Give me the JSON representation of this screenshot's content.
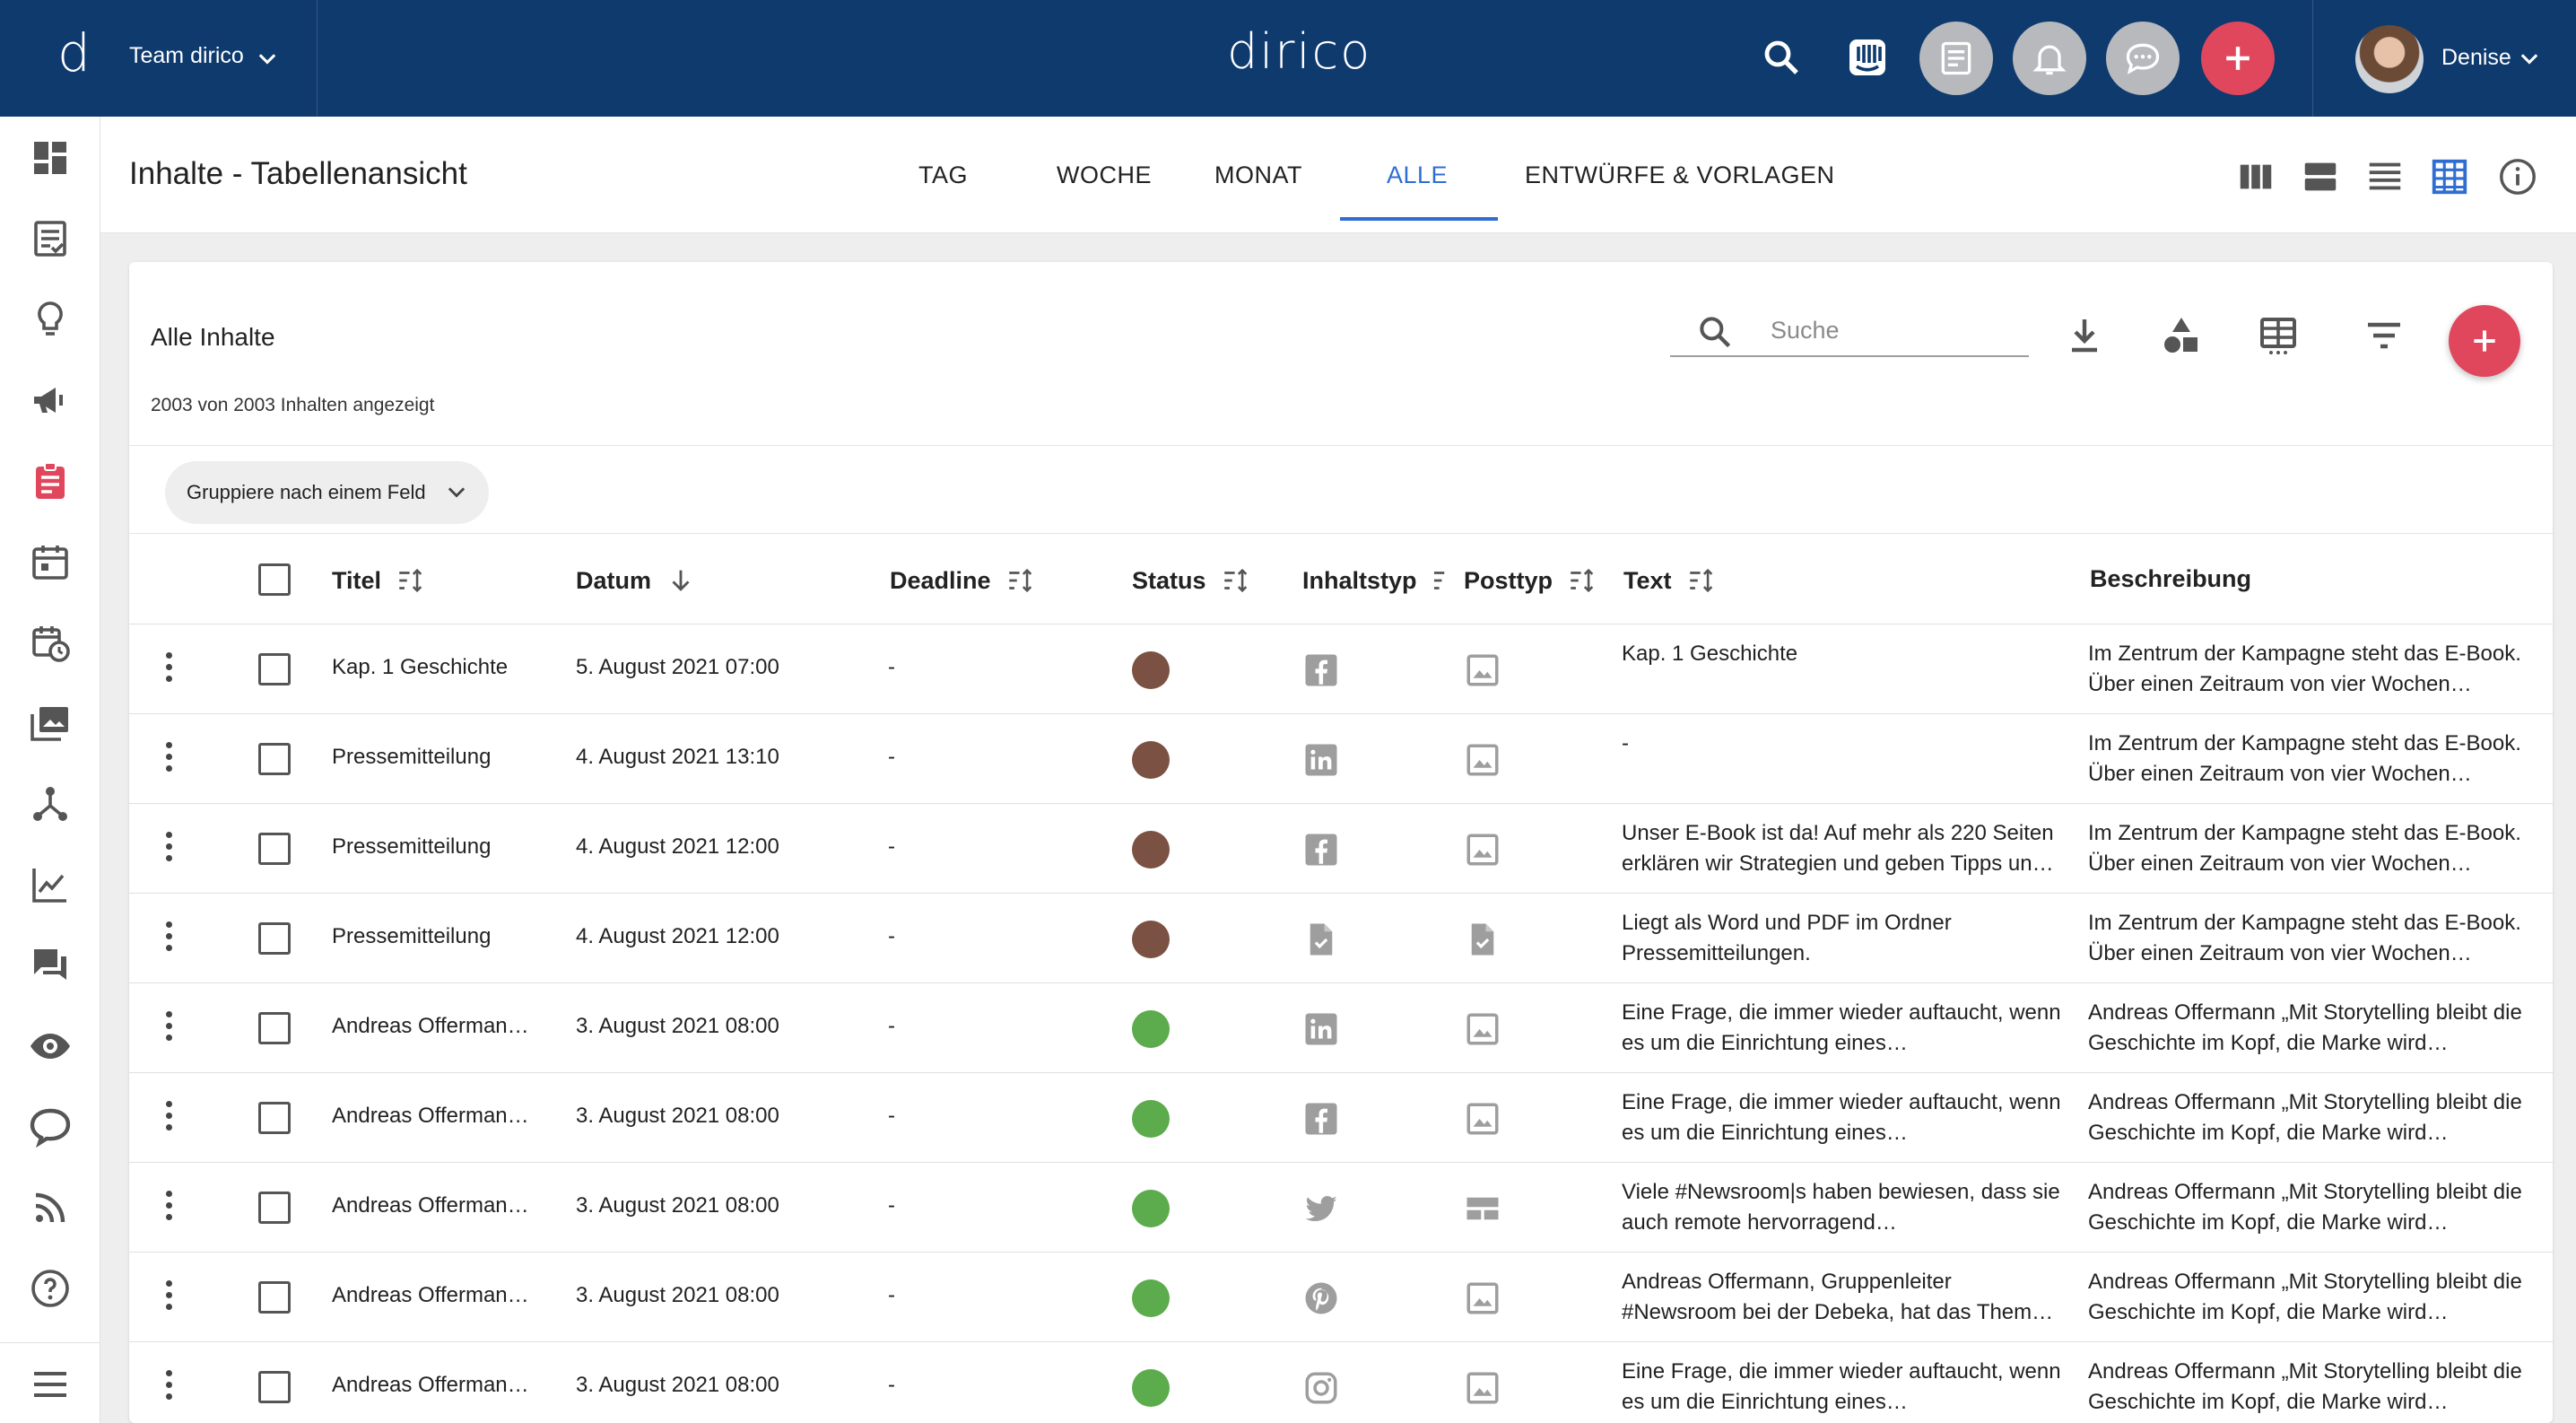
{
  "topbar": {
    "logo": "d",
    "team": "Team dirico",
    "brand": "dirico",
    "user": "Denise",
    "bg_color": "#0e3a6e",
    "accent_color": "#e0475d"
  },
  "header": {
    "title": "Inhalte - Tabellenansicht",
    "tabs": [
      {
        "label": "TAG",
        "active": false
      },
      {
        "label": "WOCHE",
        "active": false
      },
      {
        "label": "MONAT",
        "active": false
      },
      {
        "label": "ALLE",
        "active": true
      },
      {
        "label": "ENTWÜRFE & VORLAGEN",
        "active": false
      }
    ]
  },
  "card": {
    "title": "Alle Inhalte",
    "count": "2003 von 2003 Inhalten angezeigt",
    "search_placeholder": "Suche",
    "group_chip": "Gruppiere nach einem Feld"
  },
  "table": {
    "columns": {
      "title": "Titel",
      "date": "Datum",
      "deadline": "Deadline",
      "status": "Status",
      "content_type": "Inhaltstyp",
      "post_type": "Posttyp",
      "text": "Text",
      "description": "Beschreibung"
    },
    "rows": [
      {
        "title": "Kap. 1 Geschichte",
        "date": "5. August 2021 07:00",
        "deadline": "-",
        "status_color": "#7a5142",
        "content_icon": "facebook-icon",
        "post_icon": "image-icon",
        "text": "Kap. 1 Geschichte",
        "description": "Im Zentrum der Kampagne steht das E-Book. Über einen Zeitraum von vier Wochen…"
      },
      {
        "title": "Pressemitteilung",
        "date": "4. August 2021 13:10",
        "deadline": "-",
        "status_color": "#7a5142",
        "content_icon": "linkedin-icon",
        "post_icon": "image-icon",
        "text": "-",
        "description": "Im Zentrum der Kampagne steht das E-Book. Über einen Zeitraum von vier Wochen…"
      },
      {
        "title": "Pressemitteilung",
        "date": "4. August 2021 12:00",
        "deadline": "-",
        "status_color": "#7a5142",
        "content_icon": "facebook-icon",
        "post_icon": "image-icon",
        "text": "Unser E-Book ist da! Auf mehr als 220 Seiten erklären wir Strategien und geben Tipps un…",
        "description": "Im Zentrum der Kampagne steht das E-Book. Über einen Zeitraum von vier Wochen…"
      },
      {
        "title": "Pressemitteilung",
        "date": "4. August 2021 12:00",
        "deadline": "-",
        "status_color": "#7a5142",
        "content_icon": "document-check-icon",
        "post_icon": "document-check-icon",
        "text": "Liegt als Word und PDF im Ordner Pressemitteilungen.",
        "description": "Im Zentrum der Kampagne steht das E-Book. Über einen Zeitraum von vier Wochen…"
      },
      {
        "title": "Andreas Offerman…",
        "date": "3. August 2021 08:00",
        "deadline": "-",
        "status_color": "#5cab4c",
        "content_icon": "linkedin-icon",
        "post_icon": "image-icon",
        "text": "Eine Frage, die immer wieder auftaucht, wenn es um die Einrichtung eines…",
        "description": "Andreas Offermann „Mit Storytelling bleibt die Geschichte im Kopf, die Marke wird…"
      },
      {
        "title": "Andreas Offerman…",
        "date": "3. August 2021 08:00",
        "deadline": "-",
        "status_color": "#5cab4c",
        "content_icon": "facebook-icon",
        "post_icon": "image-icon",
        "text": "Eine Frage, die immer wieder auftaucht, wenn es um die Einrichtung eines…",
        "description": "Andreas Offermann „Mit Storytelling bleibt die Geschichte im Kopf, die Marke wird…"
      },
      {
        "title": "Andreas Offerman…",
        "date": "3. August 2021 08:00",
        "deadline": "-",
        "status_color": "#5cab4c",
        "content_icon": "twitter-icon",
        "post_icon": "card-layout-icon",
        "text": "Viele #Newsroom|s haben bewiesen, dass sie auch remote hervorragend…",
        "description": "Andreas Offermann „Mit Storytelling bleibt die Geschichte im Kopf, die Marke wird…"
      },
      {
        "title": "Andreas Offerman…",
        "date": "3. August 2021 08:00",
        "deadline": "-",
        "status_color": "#5cab4c",
        "content_icon": "pinterest-icon",
        "post_icon": "image-icon",
        "text": "Andreas Offermann, Gruppenleiter #Newsroom bei der Debeka, hat das Them…",
        "description": "Andreas Offermann „Mit Storytelling bleibt die Geschichte im Kopf, die Marke wird…"
      },
      {
        "title": "Andreas Offerman…",
        "date": "3. August 2021 08:00",
        "deadline": "-",
        "status_color": "#5cab4c",
        "content_icon": "instagram-icon",
        "post_icon": "image-icon",
        "text": "Eine Frage, die immer wieder auftaucht, wenn es um die Einrichtung eines…",
        "description": "Andreas Offermann „Mit Storytelling bleibt die Geschichte im Kopf, die Marke wird…"
      }
    ]
  }
}
